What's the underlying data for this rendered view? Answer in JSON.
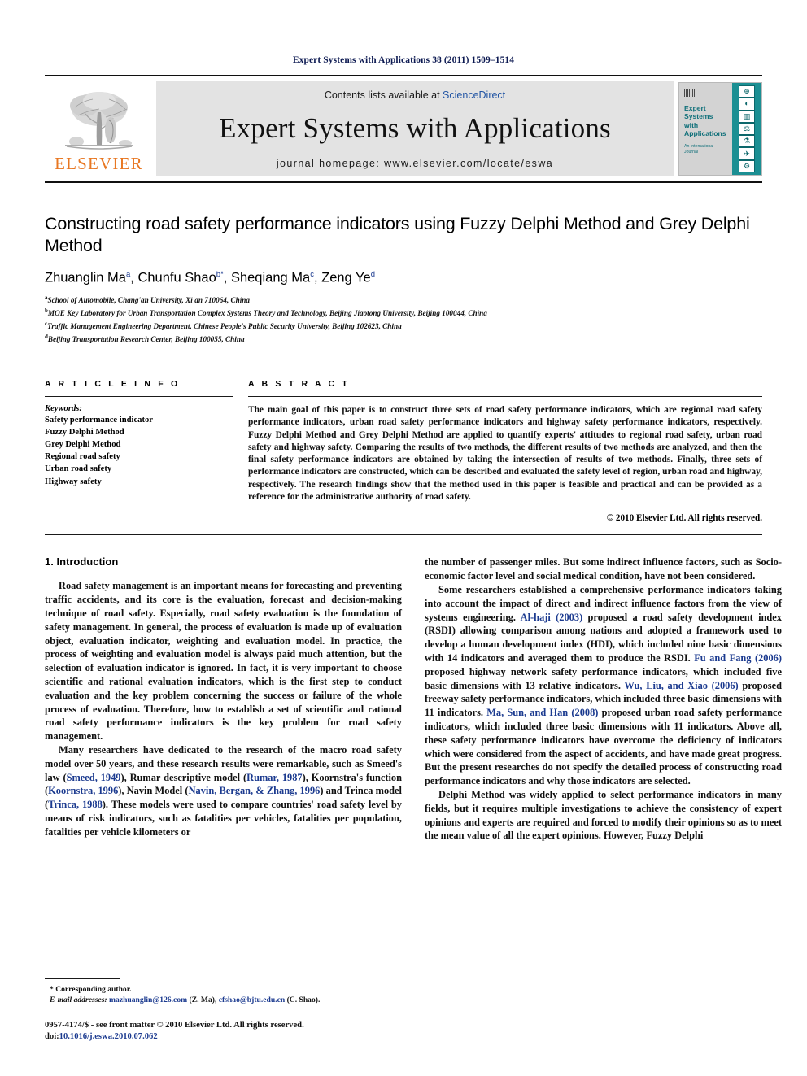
{
  "running_head": "Expert Systems with Applications 38 (2011) 1509–1514",
  "masthead": {
    "publisher_name": "ELSEVIER",
    "contents_prefix": "Contents lists available at ",
    "contents_link": "ScienceDirect",
    "journal_title": "Expert Systems with Applications",
    "homepage": "journal homepage: www.elsevier.com/locate/eswa",
    "cover": {
      "title_lines": [
        "Expert",
        "Systems",
        "with",
        "Applications"
      ],
      "subtitle": "An International Journal",
      "accent_color": "#10707a",
      "strip_color": "#1b8f93",
      "tiles": [
        "⊕",
        "◐",
        "▥",
        "⚖",
        "⚗",
        "✈",
        "⚙"
      ]
    },
    "logo_color": "#E87722"
  },
  "article": {
    "title": "Constructing road safety performance indicators using Fuzzy Delphi Method and Grey Delphi Method",
    "authors": [
      {
        "name": "Zhuanglin Ma",
        "sup": "a"
      },
      {
        "name": "Chunfu Shao",
        "sup": "b"
      },
      {
        "name": "Sheqiang Ma",
        "sup": "c"
      },
      {
        "name": "Zeng Ye",
        "sup": "d"
      }
    ],
    "authors_line": "Zhuanglin Ma a, Chunfu Shao b*, Sheqiang Ma c, Zeng Ye d",
    "affiliations": [
      {
        "sup": "a",
        "text": "School of Automobile, Chang'an University, Xi'an 710064, China"
      },
      {
        "sup": "b",
        "text": "MOE Key Laboratory for Urban Transportation Complex Systems Theory and Technology, Beijing Jiaotong University, Beijing 100044, China"
      },
      {
        "sup": "c",
        "text": "Traffic Management Engineering Department, Chinese People's Public Security University, Beijing 102623, China"
      },
      {
        "sup": "d",
        "text": "Beijing Transportation Research Center, Beijing 100055, China"
      }
    ]
  },
  "article_info": {
    "heading": "A R T I C L E    I N F O",
    "keywords_label": "Keywords:",
    "keywords": [
      "Safety performance indicator",
      "Fuzzy Delphi Method",
      "Grey Delphi Method",
      "Regional road safety",
      "Urban road safety",
      "Highway safety"
    ]
  },
  "abstract": {
    "heading": "A B S T R A C T",
    "text": "The main goal of this paper is to construct three sets of road safety performance indicators, which are regional road safety performance indicators, urban road safety performance indicators and highway safety performance indicators, respectively. Fuzzy Delphi Method and Grey Delphi Method are applied to quantify experts' attitudes to regional road safety, urban road safety and highway safety. Comparing the results of two methods, the different results of two methods are analyzed, and then the final safety performance indicators are obtained by taking the intersection of results of two methods. Finally, three sets of performance indicators are constructed, which can be described and evaluated the safety level of region, urban road and highway, respectively. The research findings show that the method used in this paper is feasible and practical and can be provided as a reference for the administrative authority of road safety.",
    "copyright": "© 2010 Elsevier Ltd. All rights reserved."
  },
  "body": {
    "section_title": "1. Introduction",
    "left_paragraphs": [
      "Road safety management is an important means for forecasting and preventing traffic accidents, and its core is the evaluation, forecast and decision-making technique of road safety. Especially, road safety evaluation is the foundation of safety management. In general, the process of evaluation is made up of evaluation object, evaluation indicator, weighting and evaluation model. In practice, the process of weighting and evaluation model is always paid much attention, but the selection of evaluation indicator is ignored. In fact, it is very important to choose scientific and rational evaluation indicators, which is the first step to conduct evaluation and the key problem concerning the success or failure of the whole process of evaluation. Therefore, how to establish a set of scientific and rational road safety performance indicators is the key problem for road safety management."
    ],
    "left_para2_parts": [
      {
        "t": "Many researchers have dedicated to the research of the macro road safety model over 50 years, and these research results were remarkable, such as Smeed's law (",
        "c": false
      },
      {
        "t": "Smeed, 1949",
        "c": true
      },
      {
        "t": "), Rumar descriptive model (",
        "c": false
      },
      {
        "t": "Rumar, 1987",
        "c": true
      },
      {
        "t": "), Koornstra's function (",
        "c": false
      },
      {
        "t": "Koornstra, 1996",
        "c": true
      },
      {
        "t": "), Navin Model (",
        "c": false
      },
      {
        "t": "Navin, Bergan, & Zhang, 1996",
        "c": true
      },
      {
        "t": ") and Trinca model (",
        "c": false
      },
      {
        "t": "Trinca, 1988",
        "c": true
      },
      {
        "t": "). These models were used to compare countries' road safety level by means of risk indicators, such as fatalities per vehicles, fatalities per population, fatalities per vehicle kilometers or",
        "c": false
      }
    ],
    "right_para1": "the number of passenger miles. But some indirect influence factors, such as Socio-economic factor level and social medical condition, have not been considered.",
    "right_para2_parts": [
      {
        "t": "Some researchers established a comprehensive performance indicators taking into account the impact of direct and indirect influence factors from the view of systems engineering. ",
        "c": false
      },
      {
        "t": "Al-haji (2003)",
        "c": true
      },
      {
        "t": " proposed a road safety development index (RSDI) allowing comparison among nations and adopted a framework used to develop a human development index (HDI), which included nine basic dimensions with 14 indicators and averaged them to produce the RSDI. ",
        "c": false
      },
      {
        "t": "Fu and Fang (2006)",
        "c": true
      },
      {
        "t": " proposed highway network safety performance indicators, which included five basic dimensions with 13 relative indicators. ",
        "c": false
      },
      {
        "t": "Wu, Liu, and Xiao (2006)",
        "c": true
      },
      {
        "t": " proposed freeway safety performance indicators, which included three basic dimensions with 11 indicators. ",
        "c": false
      },
      {
        "t": "Ma, Sun, and Han (2008)",
        "c": true
      },
      {
        "t": " proposed urban road safety performance indicators, which included three basic dimensions with 11 indicators. Above all, these safety performance indicators have overcome the deficiency of indicators which were considered from the aspect of accidents, and have made great progress. But the present researches do not specify the detailed process of constructing road performance indicators and why those indicators are selected.",
        "c": false
      }
    ],
    "right_para3": "Delphi Method was widely applied to select performance indicators in many fields, but it requires multiple investigations to achieve the consistency of expert opinions and experts are required and forced to modify their opinions so as to meet the mean value of all the expert opinions. However, Fuzzy Delphi"
  },
  "footnote": {
    "corresponding": "* Corresponding author.",
    "email_label": "E-mail addresses:",
    "email1": "mazhuanglin@126.com",
    "email1_who": "(Z. Ma)",
    "email2": "cfshao@bjtu.edu.cn",
    "email2_who": "(C. Shao).",
    "issn_line": "0957-4174/$ - see front matter © 2010 Elsevier Ltd. All rights reserved.",
    "doi_prefix": "doi:",
    "doi": "10.1016/j.eswa.2010.07.062"
  }
}
